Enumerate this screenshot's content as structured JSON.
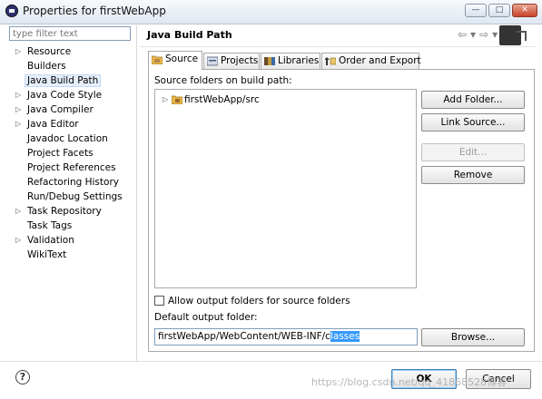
{
  "window": {
    "title": "Properties for firstWebApp",
    "buttons": [
      "minimize",
      "maximize",
      "close"
    ]
  },
  "filter": {
    "placeholder": "type filter text"
  },
  "nav": {
    "items": [
      {
        "label": "Resource",
        "expandable": true
      },
      {
        "label": "Builders",
        "expandable": false
      },
      {
        "label": "Java Build Path",
        "expandable": false,
        "selected": true
      },
      {
        "label": "Java Code Style",
        "expandable": true
      },
      {
        "label": "Java Compiler",
        "expandable": true
      },
      {
        "label": "Java Editor",
        "expandable": true
      },
      {
        "label": "Javadoc Location",
        "expandable": false
      },
      {
        "label": "Project Facets",
        "expandable": false
      },
      {
        "label": "Project References",
        "expandable": false
      },
      {
        "label": "Refactoring History",
        "expandable": false
      },
      {
        "label": "Run/Debug Settings",
        "expandable": false
      },
      {
        "label": "Task Repository",
        "expandable": true
      },
      {
        "label": "Task Tags",
        "expandable": false
      },
      {
        "label": "Validation",
        "expandable": true
      },
      {
        "label": "WikiText",
        "expandable": false
      }
    ]
  },
  "page": {
    "title": "Java Build Path"
  },
  "tabs": [
    {
      "label": "Source",
      "active": true,
      "icon": "source-folder-icon"
    },
    {
      "label": "Projects",
      "active": false,
      "icon": "projects-icon"
    },
    {
      "label": "Libraries",
      "active": false,
      "icon": "libraries-icon"
    },
    {
      "label": "Order and Export",
      "active": false,
      "icon": "order-export-icon"
    }
  ],
  "source": {
    "folders_label": "Source folders on build path:",
    "tree": [
      {
        "label": "firstWebApp/src",
        "icon": "package-folder-icon",
        "expandable": true
      }
    ],
    "buttons": {
      "add_folder": "Add Folder...",
      "link_source": "Link Source...",
      "edit": "Edit...",
      "remove": "Remove"
    },
    "allow_output_label": "Allow output folders for source folders",
    "allow_output_checked": false,
    "default_output_label": "Default output folder:",
    "default_output_prefix": "firstWebApp/WebContent/WEB-INF/c",
    "default_output_selected": "lasses",
    "browse": "Browse..."
  },
  "footer": {
    "help_symbol": "?",
    "ok": "OK",
    "cancel": "Cancel"
  },
  "watermark": "https://blog.csdn.net/qq_41868528博客"
}
